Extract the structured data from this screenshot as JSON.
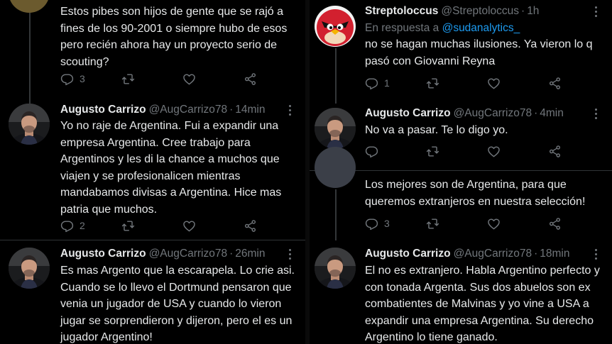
{
  "left_column": {
    "tweets": [
      {
        "name": "",
        "handle": "",
        "time": "",
        "text": "Estos pibes son hijos de gente que se rajó a fines de los 90-2001 o siempre hubo de esos pero recién ahora hay un proyecto serio de scouting?",
        "replies": "3",
        "retweets": "",
        "likes": ""
      },
      {
        "name": "Augusto Carrizo",
        "handle": "@AugCarrizo78",
        "time": "14min",
        "text": "Yo no raje de Argentina. Fui a expandir una empresa Argentina. Cree trabajo para Argentinos y les di la chance a muchos que viajen y se profesionalicen mientras mandabamos divisas a Argentina. Hice mas patria que muchos.",
        "replies": "2",
        "retweets": "",
        "likes": ""
      },
      {
        "name": "Augusto Carrizo",
        "handle": "@AugCarrizo78",
        "time": "26min",
        "text": "Es mas Argento que la escarapela. Lo crie asi. Cuando se lo llevo el Dortmund pensaron que venia un jugador de USA y cuando lo vieron jugar se sorprendieron y dijeron, pero el es un jugador Argentino!"
      }
    ]
  },
  "right_column": {
    "tweets": [
      {
        "name": "Streptoloccus",
        "handle": "@Streptoloccus",
        "time": "1h",
        "reply_prefix": "En respuesta a",
        "reply_mention": "@sudanalytics_",
        "text": "no se hagan muchas ilusiones. Ya vieron lo q pasó con Giovanni Reyna",
        "replies": "1",
        "retweets": "",
        "likes": ""
      },
      {
        "name": "Augusto Carrizo",
        "handle": "@AugCarrizo78",
        "time": "4min",
        "text": "No va a pasar. Te lo digo yo.",
        "replies": "",
        "retweets": "",
        "likes": ""
      },
      {
        "name": "",
        "handle": "",
        "time": "",
        "text": "Los mejores son de Argentina, para que queremos extranjeros en nuestra selección!",
        "replies": "3",
        "retweets": "",
        "likes": ""
      },
      {
        "name": "Augusto Carrizo",
        "handle": "@AugCarrizo78",
        "time": "18min",
        "text": "El no es extranjero. Habla Argentino perfecto y con tonada Argenta. Sus dos abuelos son ex combatientes de Malvinas y yo vine a USA a expandir una empresa Argentina. Su derecho Argentino lo tiene ganado."
      }
    ]
  },
  "separator_dot": "·",
  "icons": {
    "reply": "reply-icon",
    "retweet": "retweet-icon",
    "like": "heart-icon",
    "share": "share-icon",
    "more": "more-icon"
  },
  "colors": {
    "background": "#000000",
    "text": "#e7e9ea",
    "secondary": "#71767b",
    "link": "#1d9bf0",
    "divider": "#2f3336",
    "angry_bird_red": "#d2202f"
  }
}
